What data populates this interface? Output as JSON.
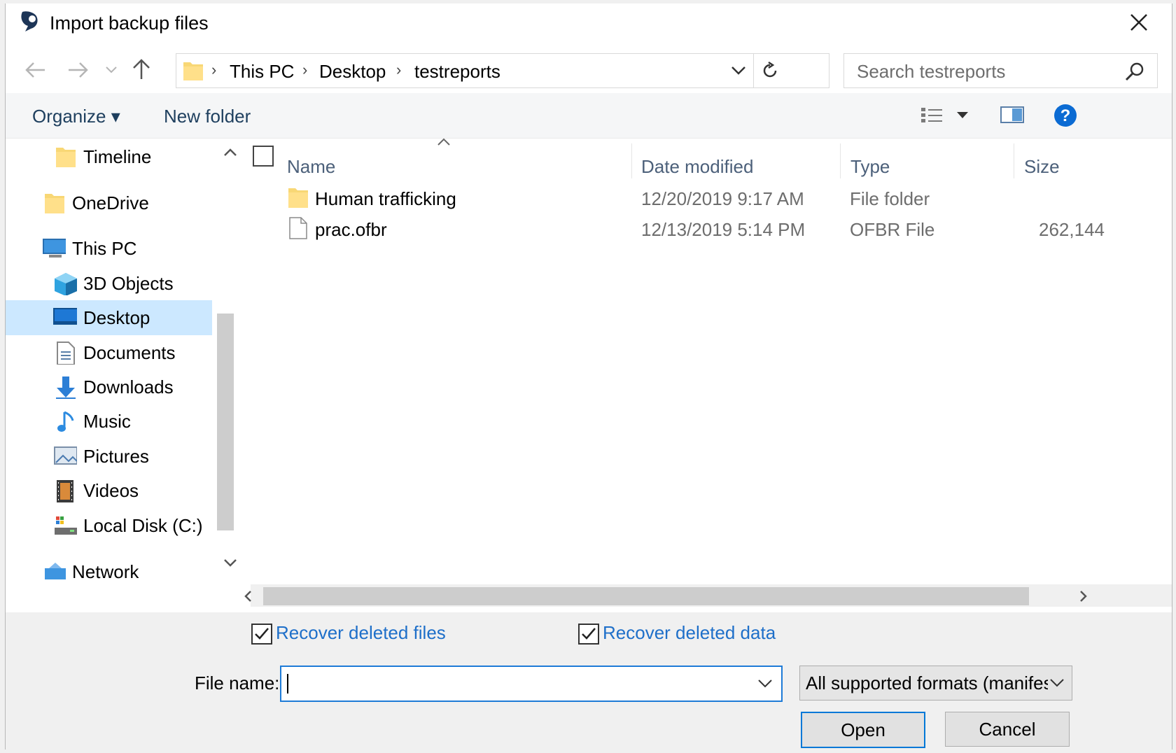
{
  "window": {
    "title": "Import backup files"
  },
  "address": {
    "breadcrumbs": [
      "This PC",
      "Desktop",
      "testreports"
    ],
    "search_placeholder": "Search testreports"
  },
  "toolbar": {
    "organize": "Organize ▾",
    "new_folder": "New folder"
  },
  "nav": {
    "items": [
      {
        "label": "Timeline",
        "icon": "folder-icon"
      },
      {
        "label": "OneDrive",
        "icon": "folder-icon"
      },
      {
        "label": "This PC",
        "icon": "computer-icon"
      },
      {
        "label": "3D Objects",
        "icon": "cube-icon"
      },
      {
        "label": "Desktop",
        "icon": "desktop-icon",
        "selected": true
      },
      {
        "label": "Documents",
        "icon": "document-icon"
      },
      {
        "label": "Downloads",
        "icon": "download-icon"
      },
      {
        "label": "Music",
        "icon": "music-icon"
      },
      {
        "label": "Pictures",
        "icon": "picture-icon"
      },
      {
        "label": "Videos",
        "icon": "video-icon"
      },
      {
        "label": "Local Disk (C:)",
        "icon": "disk-icon"
      },
      {
        "label": "Network",
        "icon": "network-icon"
      }
    ]
  },
  "columns": {
    "name": "Name",
    "date": "Date modified",
    "type": "Type",
    "size": "Size"
  },
  "files": [
    {
      "name": "Human trafficking",
      "date": "12/20/2019 9:17 AM",
      "type": "File folder",
      "size": ""
    },
    {
      "name": "prac.ofbr",
      "date": "12/13/2019 5:14 PM",
      "type": "OFBR File",
      "size": "262,144"
    }
  ],
  "options": {
    "recover_files": "Recover deleted files",
    "recover_data": "Recover deleted data"
  },
  "footer": {
    "file_name_label": "File name:",
    "file_name_value": "",
    "filter": "All supported formats (manifes",
    "open": "Open",
    "cancel": "Cancel"
  },
  "colors": {
    "accent": "#0078d7",
    "selected": "#cce8ff",
    "link": "#1e6fc9"
  }
}
